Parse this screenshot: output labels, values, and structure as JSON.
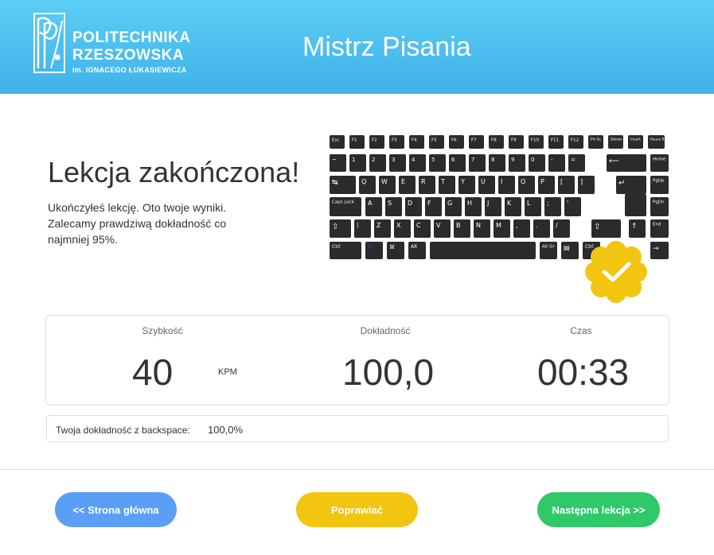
{
  "header": {
    "logo": {
      "line1": "POLITECHNIKA",
      "line2": "RZESZOWSKA",
      "line3": "im. IGNACEGO ŁUKASIEWICZA"
    },
    "app_title": "Mistrz Pisania"
  },
  "result": {
    "headline": "Lekcja zakończona!",
    "desc_line1": "Ukończyłeś lekcję. Oto twoje wyniki.",
    "desc_line2": "Zalecamy prawdziwą dokładność co najmniej 95%."
  },
  "stats": {
    "speed": {
      "label": "Szybkość",
      "value": "40",
      "unit": "KPM"
    },
    "accuracy": {
      "label": "Dokładność",
      "value": "100,0"
    },
    "time": {
      "label": "Czas",
      "value": "00:33"
    }
  },
  "backspace": {
    "label": "Twoja dokładność z backspace:",
    "value": "100,0%"
  },
  "buttons": {
    "home": "<<  Strona główna",
    "fix": "Poprawiać",
    "next": "Następna lekcja >>"
  },
  "keyboard": {
    "fn_row": [
      "Esc",
      "F1",
      "F2",
      "F3",
      "F4",
      "F5",
      "F6",
      "F7",
      "F8",
      "F9",
      "F10",
      "F11",
      "F12",
      "Prt Sc",
      "Delete",
      "Insert",
      "Pause Break"
    ],
    "row1": [
      "~",
      "1",
      "2",
      "3",
      "4",
      "5",
      "6",
      "7",
      "8",
      "9",
      "0",
      "-",
      "="
    ],
    "row2": [
      "Q",
      "W",
      "E",
      "R",
      "T",
      "Y",
      "U",
      "I",
      "O",
      "P",
      "[",
      "]"
    ],
    "row3": [
      "A",
      "S",
      "D",
      "F",
      "G",
      "H",
      "J",
      "K",
      "L",
      ";",
      "'"
    ],
    "row4": [
      "Z",
      "X",
      "C",
      "V",
      "B",
      "N",
      "M",
      ",",
      ".",
      "/"
    ],
    "keys": {
      "home": "Home",
      "pgup": "PgUp",
      "pgdn": "PgDn",
      "end": "End",
      "caps": "Caps Lock",
      "ctrl": "Ctrl",
      "fn": "Fn",
      "alt": "Alt",
      "altgr": "Alt Gr"
    },
    "colors": {
      "case": "#e6e6e6",
      "key": "#2c2a2d",
      "legend": "#ffffff",
      "fn_legend": "#3a47c9"
    }
  },
  "colors": {
    "header_top": "#5ccdf5",
    "header_bottom": "#3fb2ea",
    "btn_home": "#5b9ef7",
    "btn_fix": "#f2c510",
    "btn_next": "#2fc96a",
    "badge": "#f2c510"
  },
  "icons": {
    "logo": "politechnika-logo-mark",
    "badge": "checkmark-badge-icon"
  }
}
